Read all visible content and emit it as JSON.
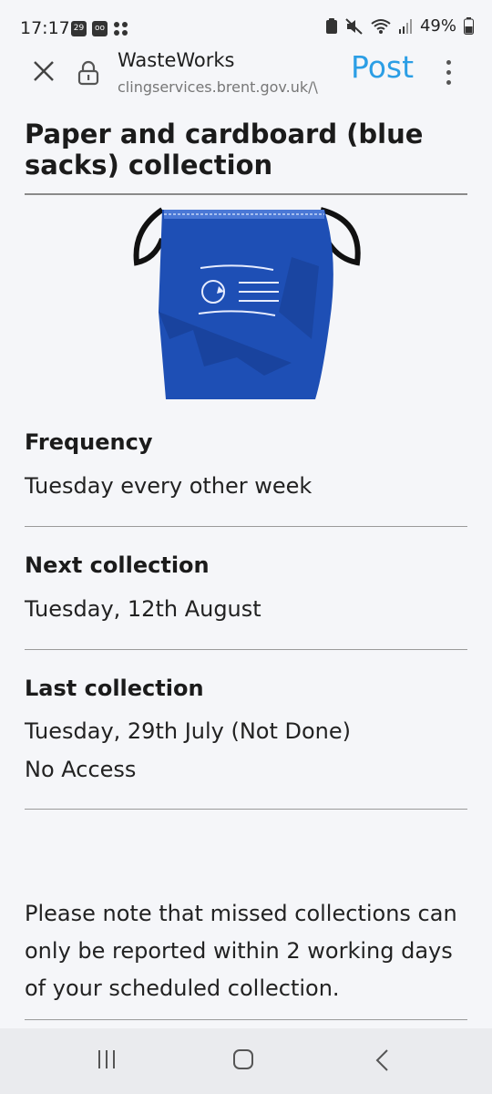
{
  "status_bar": {
    "time": "17:17",
    "calendar_badge": "29",
    "battery": "49%",
    "icons": [
      "calendar-icon",
      "voicemail-icon",
      "grid-icon",
      "clipboard-icon",
      "mute-icon",
      "wifi-icon",
      "signal-icon",
      "battery-icon"
    ]
  },
  "browser": {
    "title": "WasteWorks",
    "url": "clingservices.brent.gov.uk/\\",
    "action_label": "Post",
    "icons": [
      "close-icon",
      "lock-icon",
      "more-vert-icon"
    ]
  },
  "page": {
    "title": "Paper and cardboard (blue sacks) collection",
    "bin_color": "#1e4fb5",
    "sections": [
      {
        "label": "Frequency",
        "value": "Tuesday every other week"
      },
      {
        "label": "Next collection",
        "value": "Tuesday, 12th August"
      },
      {
        "label": "Last collection",
        "value": "Tuesday, 29th July (Not Done)",
        "value2": "No Access"
      }
    ],
    "note": "Please note that missed collections can only be reported within 2 working days of your scheduled collection."
  },
  "nav_bar": {
    "icons": [
      "recents-icon",
      "home-icon",
      "back-icon"
    ]
  }
}
